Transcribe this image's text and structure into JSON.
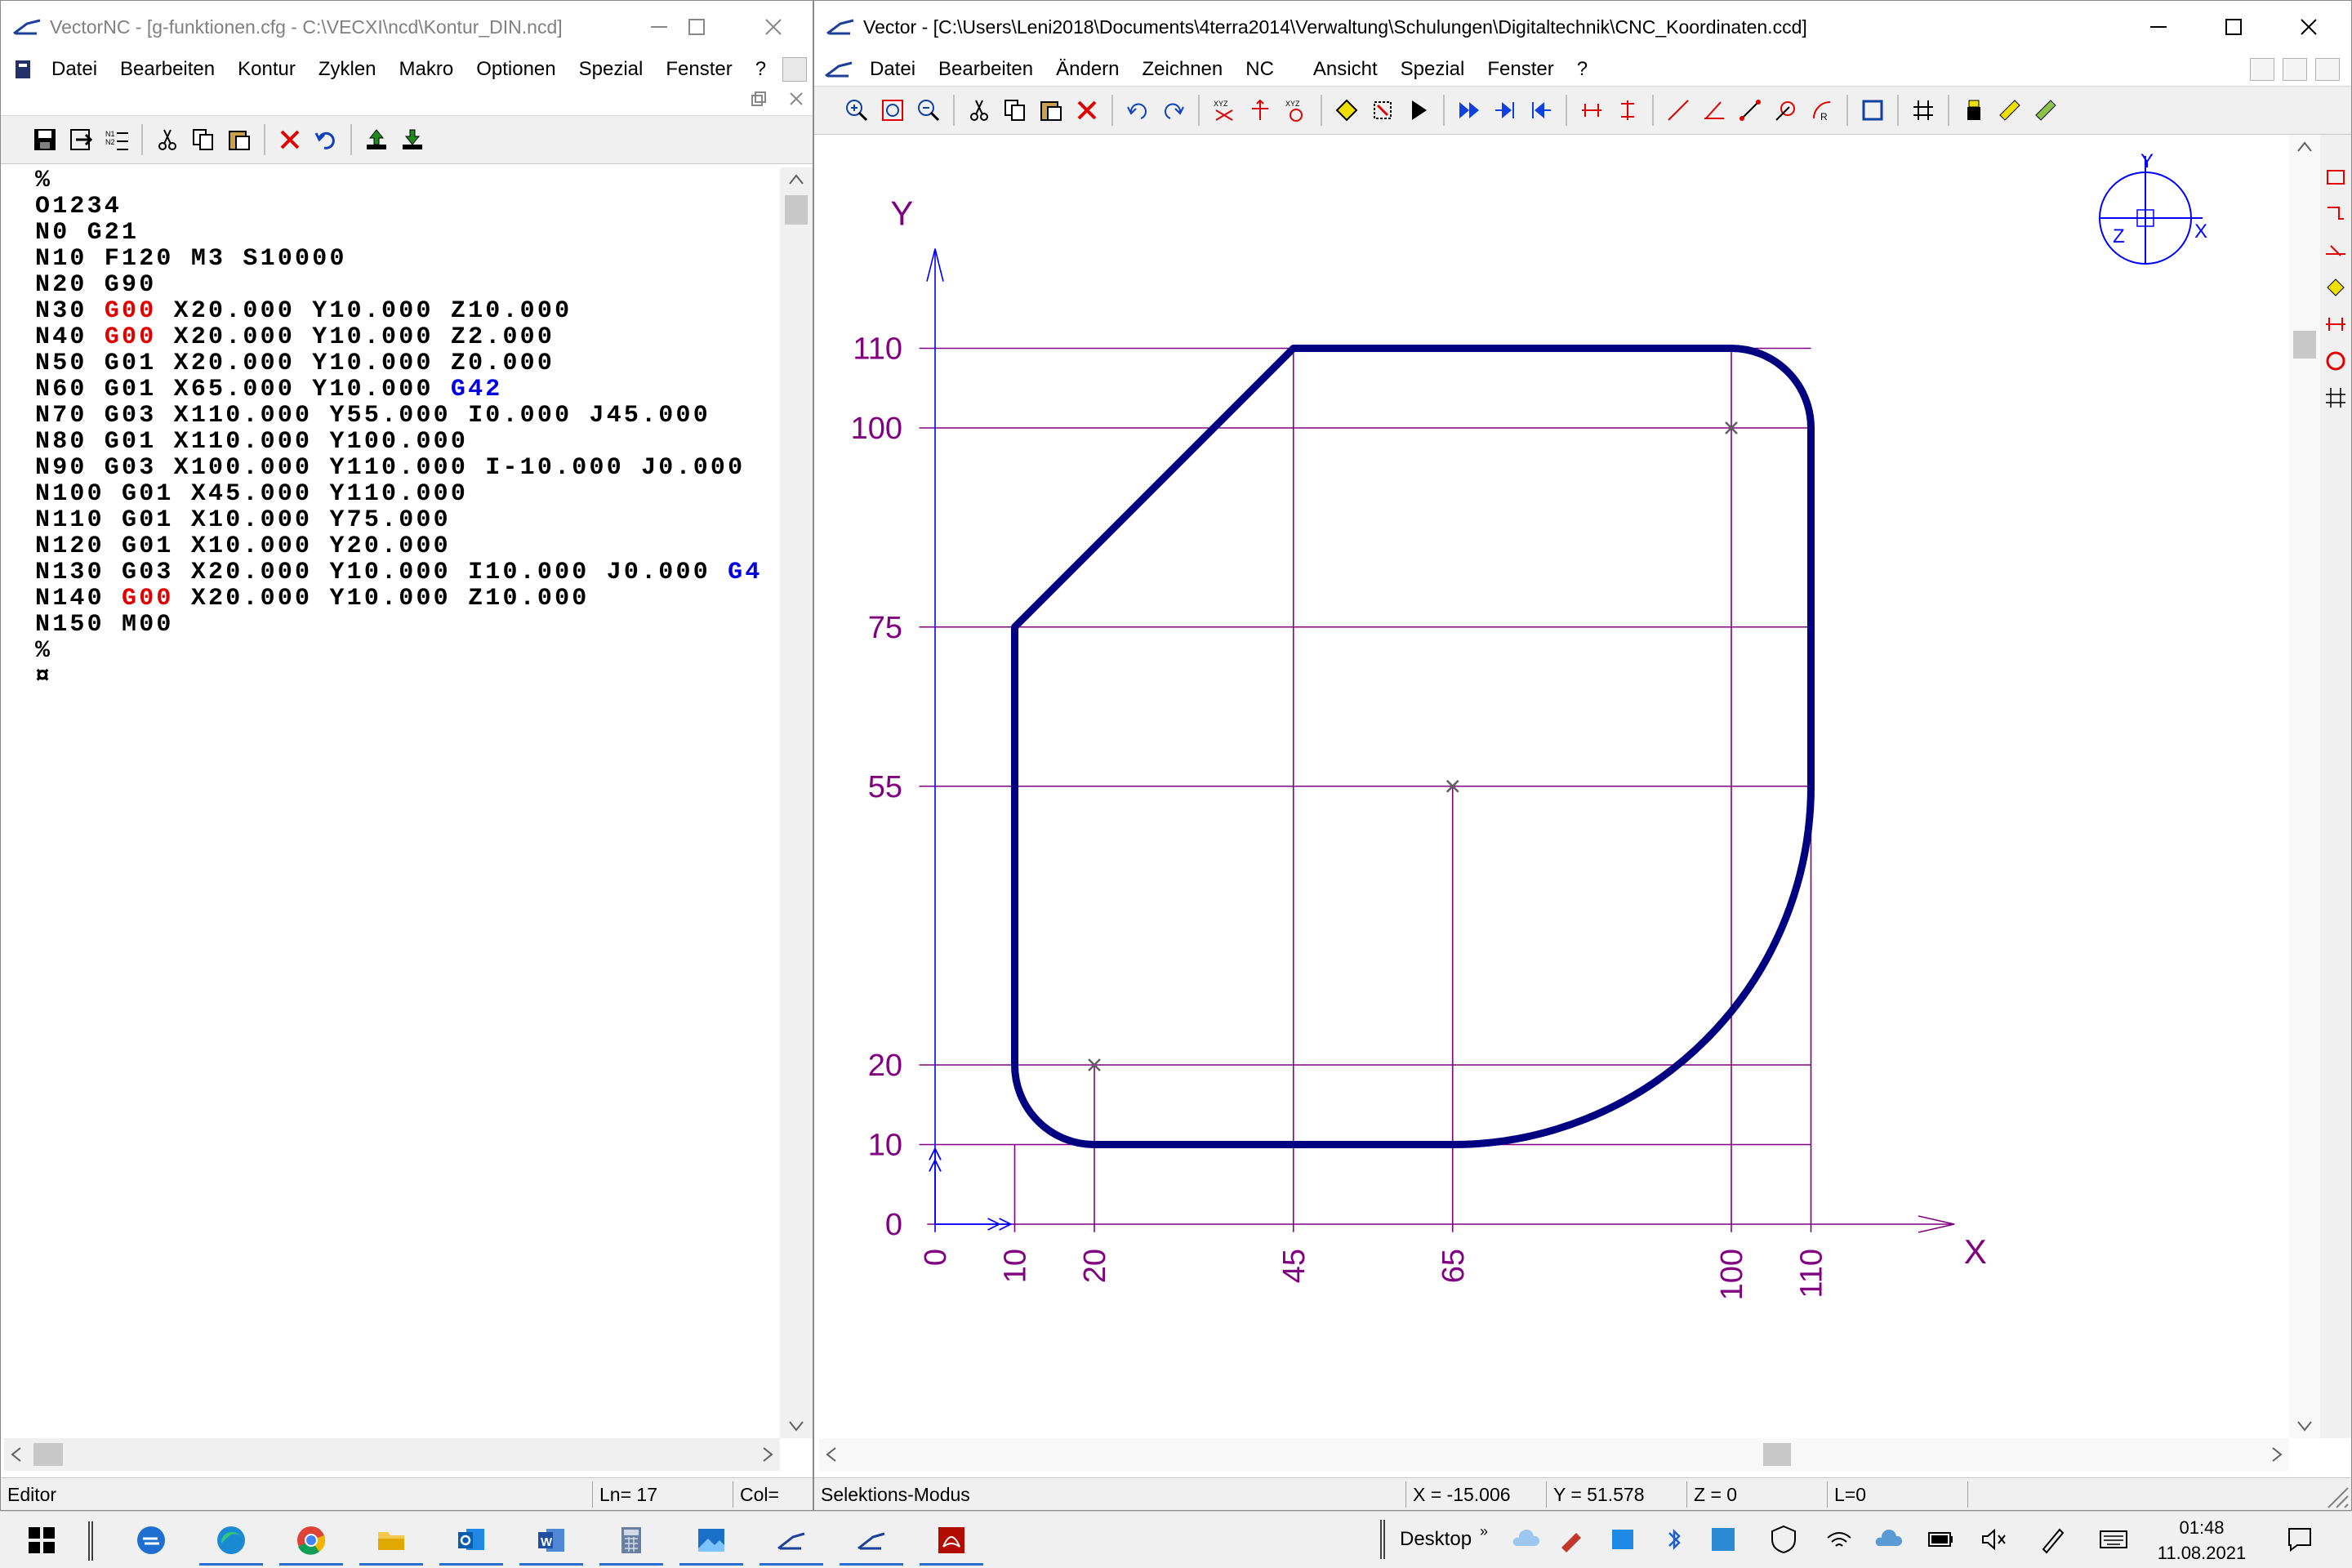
{
  "left_window": {
    "title": "VectorNC - [g-funktionen.cfg - C:\\VECXI\\ncd\\Kontur_DIN.ncd]",
    "menu": [
      "Datei",
      "Bearbeiten",
      "Kontur",
      "Zyklen",
      "Makro",
      "Optionen",
      "Spezial",
      "Fenster",
      "?"
    ],
    "toolbar_icons": [
      "save-icon",
      "export-icon",
      "list-icon",
      "cut-icon",
      "copy-icon",
      "paste-icon",
      "delete-icon",
      "undo-icon",
      "upload-icon",
      "download-icon"
    ],
    "code_lines": [
      [
        {
          "t": "%",
          "c": ""
        }
      ],
      [
        {
          "t": "O1234",
          "c": ""
        }
      ],
      [
        {
          "t": "N0 G21",
          "c": ""
        }
      ],
      [
        {
          "t": "N10 F120 M3 S10000",
          "c": ""
        }
      ],
      [
        {
          "t": "N20 G90",
          "c": ""
        }
      ],
      [
        {
          "t": "N30 ",
          "c": ""
        },
        {
          "t": "G00",
          "c": "red"
        },
        {
          "t": " X20.000 Y10.000 Z10.000",
          "c": ""
        }
      ],
      [
        {
          "t": "N40 ",
          "c": ""
        },
        {
          "t": "G00",
          "c": "red"
        },
        {
          "t": " X20.000 Y10.000 Z2.000",
          "c": ""
        }
      ],
      [
        {
          "t": "N50 G01 X20.000 Y10.000 Z0.000",
          "c": ""
        }
      ],
      [
        {
          "t": "N60 G01 X65.000 Y10.000 ",
          "c": ""
        },
        {
          "t": "G42",
          "c": "blue"
        }
      ],
      [
        {
          "t": "N70 G03 X110.000 Y55.000 I0.000 J45.000",
          "c": ""
        }
      ],
      [
        {
          "t": "N80 G01 X110.000 Y100.000",
          "c": ""
        }
      ],
      [
        {
          "t": "N90 G03 X100.000 Y110.000 I-10.000 J0.000",
          "c": ""
        }
      ],
      [
        {
          "t": "N100 G01 X45.000 Y110.000",
          "c": ""
        }
      ],
      [
        {
          "t": "N110 G01 X10.000 Y75.000",
          "c": ""
        }
      ],
      [
        {
          "t": "N120 G01 X10.000 Y20.000",
          "c": ""
        }
      ],
      [
        {
          "t": "N130 G03 X20.000 Y10.000 I10.000 J0.000 ",
          "c": ""
        },
        {
          "t": "G4",
          "c": "blue"
        }
      ],
      [
        {
          "t": "N140 ",
          "c": ""
        },
        {
          "t": "G00",
          "c": "red"
        },
        {
          "t": " X20.000 Y10.000 Z10.000",
          "c": ""
        }
      ],
      [
        {
          "t": "N150 M00",
          "c": ""
        }
      ],
      [
        {
          "t": "%",
          "c": ""
        }
      ],
      [
        {
          "t": "¤",
          "c": ""
        }
      ]
    ],
    "status": {
      "mode": "Editor",
      "line": "Ln= 17",
      "col": "Col="
    }
  },
  "right_window": {
    "title": "Vector - [C:\\Users\\Leni2018\\Documents\\4terra2014\\Verwaltung\\Schulungen\\Digitaltechnik\\CNC_Koordinaten.ccd]",
    "menu": [
      "Datei",
      "Bearbeiten",
      "Ändern",
      "Zeichnen",
      "NC",
      "Ansicht",
      "Spezial",
      "Fenster",
      "?"
    ],
    "toolbar_icons": [
      "zoom-in-icon",
      "zoom-window-icon",
      "zoom-out-icon",
      "cut-icon",
      "copy-icon",
      "paste-icon",
      "delete-icon",
      "undo-icon",
      "redo-icon",
      "xyz-origin-icon",
      "move-icon",
      "xyz-rotate-icon",
      "diamond-icon",
      "measure-icon",
      "select-arrow-icon",
      "play-fast-icon",
      "step-forward-icon",
      "step-back-icon",
      "dimension-h-icon",
      "dimension-v-icon",
      "line-icon",
      "angle-line-icon",
      "line-length-icon",
      "circle-tangent-icon",
      "radius-icon",
      "rectangle-icon",
      "grid-icon",
      "tool-icon",
      "ruler-icon",
      "ruler-check-icon"
    ],
    "side_icons": [
      "rect-side-icon",
      "step-side-icon",
      "angle-side-icon",
      "diamond-side-icon",
      "dimension-side-icon",
      "circle-side-icon",
      "grid-side-icon"
    ],
    "status": {
      "mode": "Selektions-Modus",
      "x": "X = -15.006",
      "y": "Y = 51.578",
      "z": "Z = 0",
      "l": "L=0"
    }
  },
  "chart_data": {
    "type": "line",
    "title": "",
    "xlabel": "X",
    "ylabel": "Y",
    "xlim": [
      0,
      130
    ],
    "ylim": [
      0,
      120
    ],
    "x_ticks": [
      0,
      10,
      20,
      45,
      65,
      100,
      110
    ],
    "y_ticks": [
      0,
      10,
      20,
      55,
      75,
      100,
      110
    ],
    "contour": [
      {
        "type": "line",
        "from": [
          20,
          10
        ],
        "to": [
          65,
          10
        ]
      },
      {
        "type": "arc_ccw",
        "from": [
          65,
          10
        ],
        "to": [
          110,
          55
        ],
        "center": [
          65,
          55
        ]
      },
      {
        "type": "line",
        "from": [
          110,
          55
        ],
        "to": [
          110,
          100
        ]
      },
      {
        "type": "arc_ccw",
        "from": [
          110,
          100
        ],
        "to": [
          100,
          110
        ],
        "center": [
          100,
          100
        ]
      },
      {
        "type": "line",
        "from": [
          100,
          110
        ],
        "to": [
          45,
          110
        ]
      },
      {
        "type": "line",
        "from": [
          45,
          110
        ],
        "to": [
          10,
          75
        ]
      },
      {
        "type": "line",
        "from": [
          10,
          75
        ],
        "to": [
          10,
          20
        ]
      },
      {
        "type": "arc_ccw",
        "from": [
          10,
          20
        ],
        "to": [
          20,
          10
        ],
        "center": [
          20,
          20
        ]
      }
    ],
    "arc_centers": [
      [
        20,
        20
      ],
      [
        65,
        55
      ],
      [
        100,
        100
      ]
    ],
    "orientation_axes": [
      "Y",
      "Z",
      "X"
    ],
    "colors": {
      "contour": "#000080",
      "grid": "#800080",
      "axis": "#0000ff"
    }
  },
  "taskbar": {
    "apps": [
      "start-icon",
      "sync-icon",
      "edge-icon",
      "chrome-icon",
      "explorer-icon",
      "outlook-icon",
      "word-icon",
      "calculator-icon",
      "photos-icon",
      "vectornc-icon",
      "vector-icon",
      "pdf-icon"
    ],
    "desktop_label": "Desktop",
    "time": "01:48",
    "date": "11.08.2021"
  }
}
